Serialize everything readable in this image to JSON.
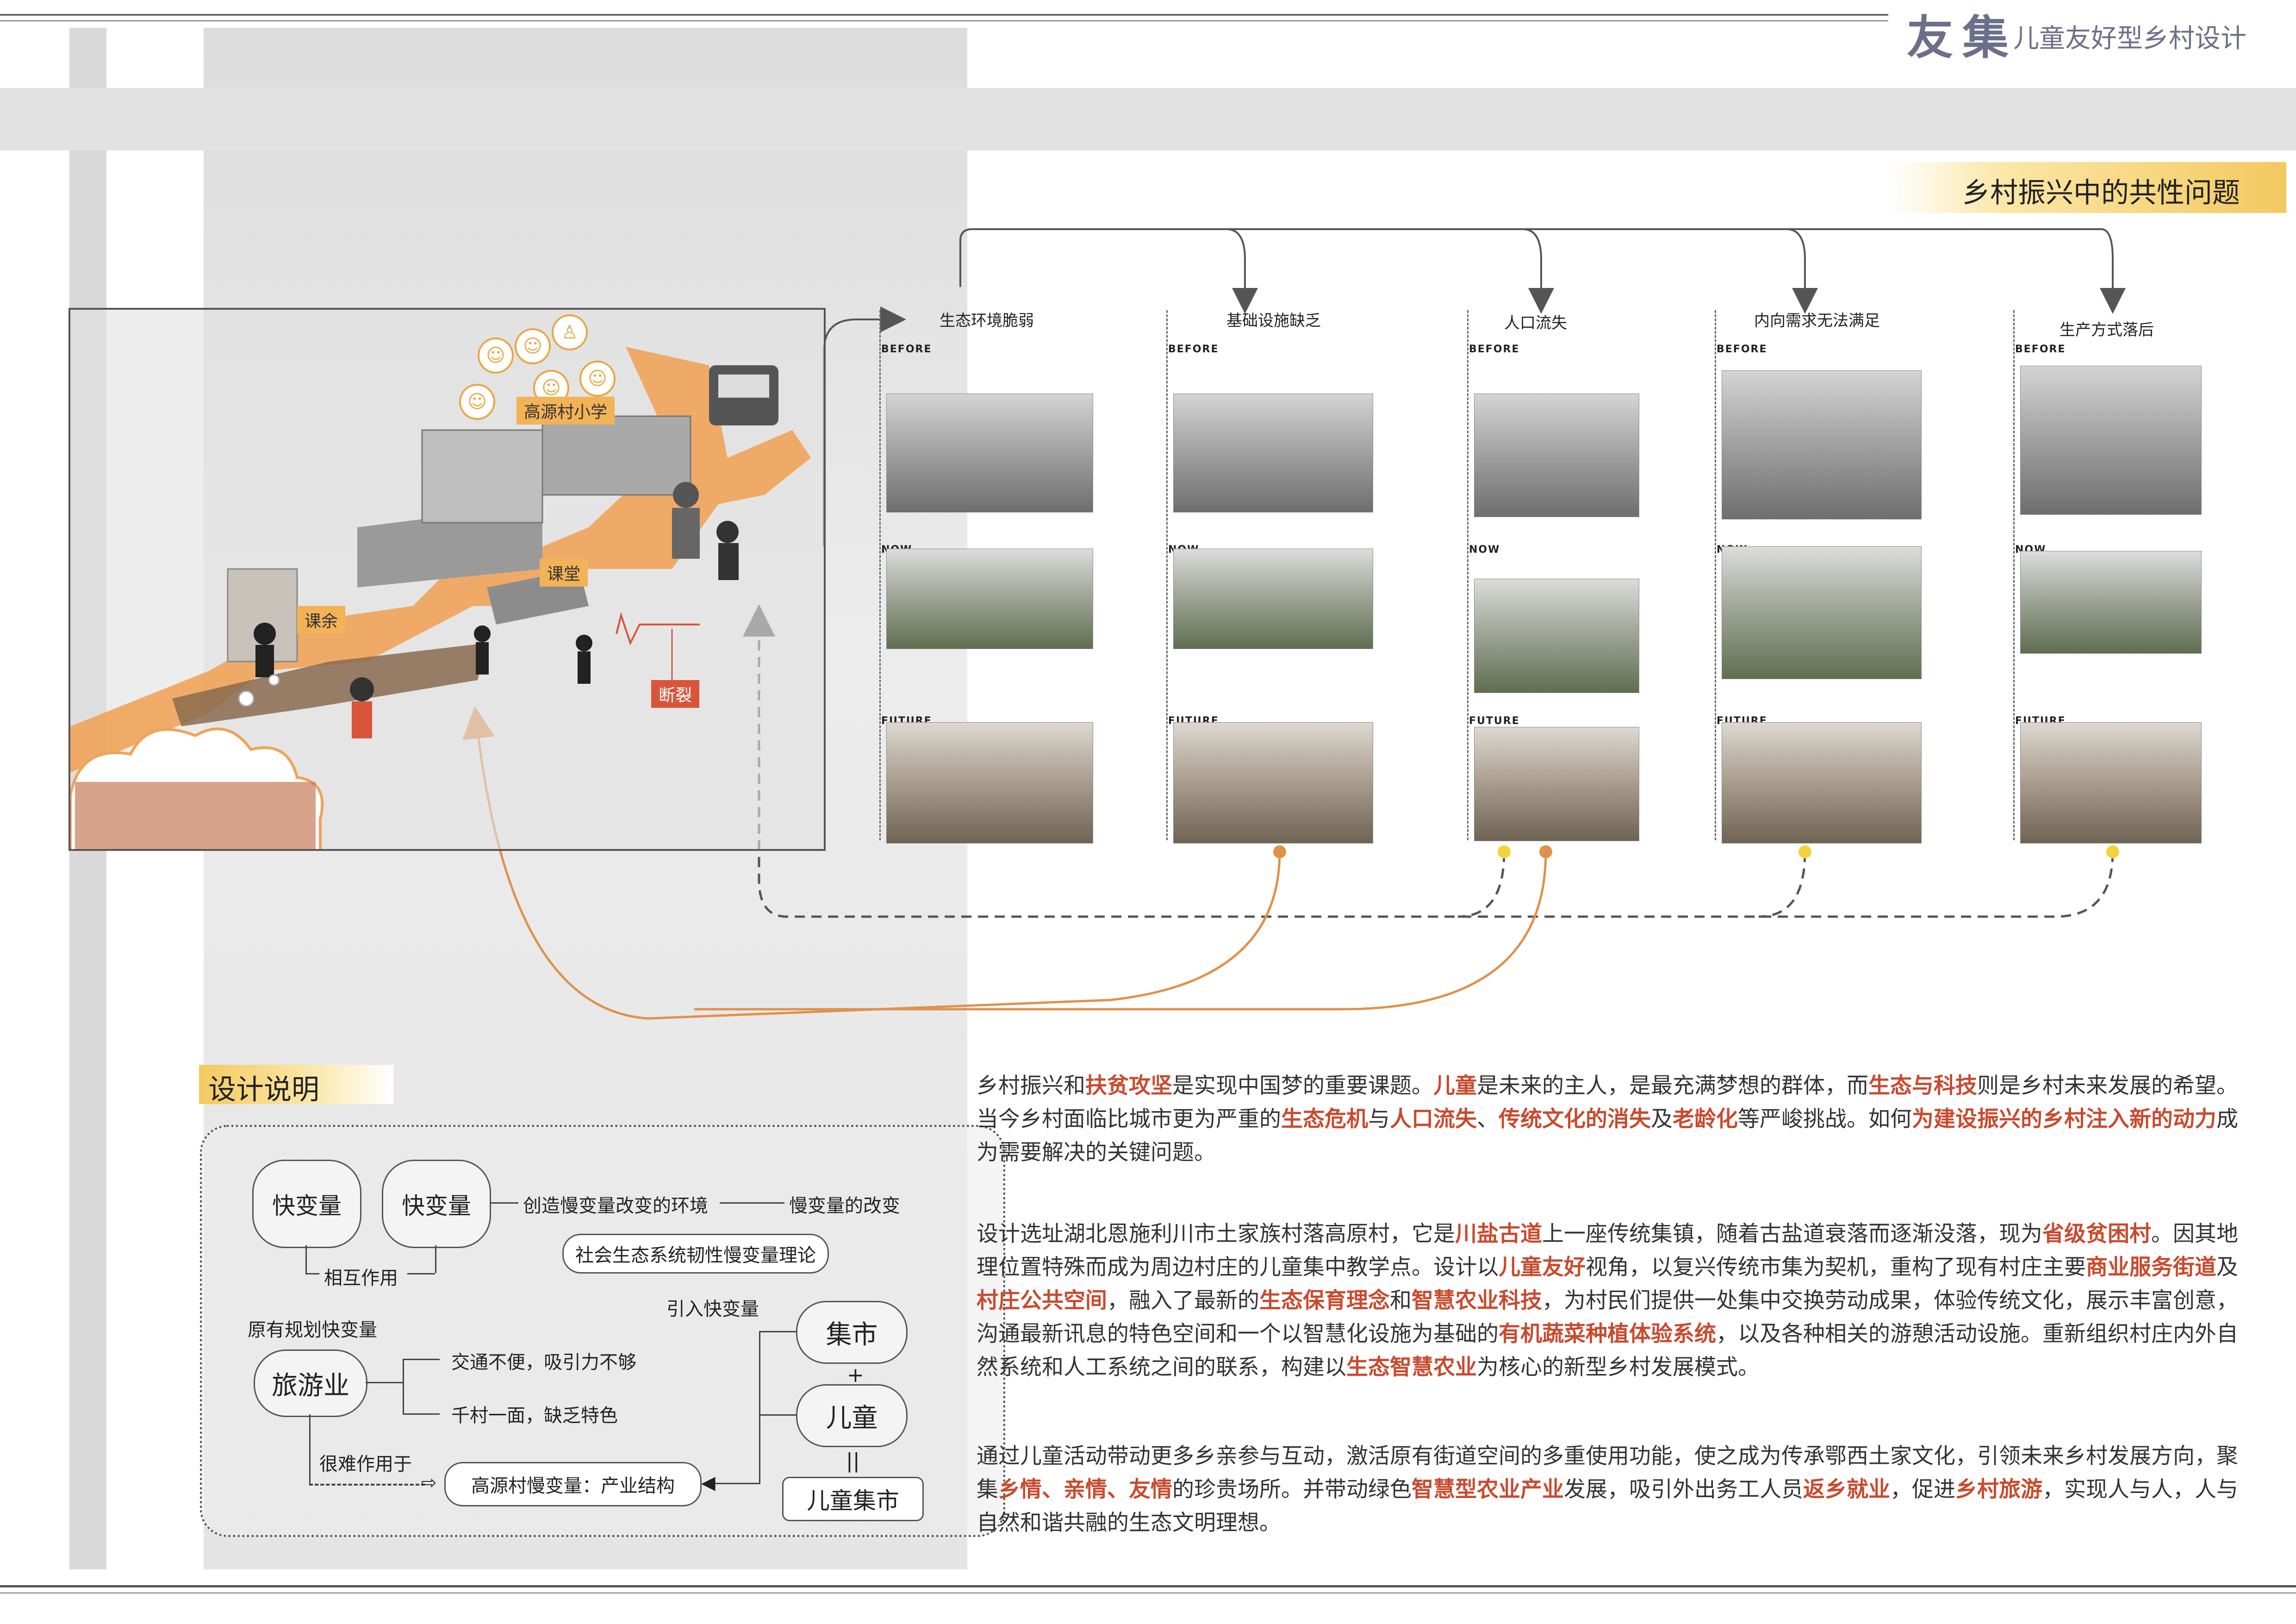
{
  "header": {
    "brand": "友集",
    "subtitle": "儿童友好型乡村设计"
  },
  "problems": {
    "title": "乡村振兴中的共性问题",
    "stages": [
      "BEFORE",
      "NOW",
      "FUTURE"
    ],
    "columns": [
      {
        "title": "生态环境脆弱"
      },
      {
        "title": "基础设施缺乏"
      },
      {
        "title": "人口流失"
      },
      {
        "title": "内向需求无法满足"
      },
      {
        "title": "生产方式落后"
      }
    ]
  },
  "site_map": {
    "labels": {
      "school": "高源村小学",
      "classroom": "课堂",
      "afterclass": "课余",
      "break": "断裂"
    }
  },
  "design": {
    "title": "设计说明",
    "bubble_fast1": "快变量",
    "bubble_fast2": "快变量",
    "create_env": "创造慢变量改变的环境",
    "slow_change": "慢变量的改变",
    "interaction": "相互作用",
    "theory": "社会生态系统韧性慢变量理论",
    "original_fast": "原有规划快变量",
    "introduce_fast": "引入快变量",
    "tourism": "旅游业",
    "traffic": "交通不便，吸引力不够",
    "uniform": "千村一面，缺乏特色",
    "market": "集市",
    "plus": "+",
    "children": "儿童",
    "equals": "||",
    "hard_effect": "很难作用于",
    "slow_var": "高源村慢变量：产业结构",
    "children_market": "儿童集市"
  },
  "paragraphs": {
    "p1": [
      {
        "t": "乡村振兴和"
      },
      {
        "t": "扶贫攻坚",
        "em": true
      },
      {
        "t": "是实现中国梦的重要课题。"
      },
      {
        "t": "儿童",
        "em": true
      },
      {
        "t": "是未来的主人，是最充满梦想的群体，而"
      },
      {
        "t": "生态与科技",
        "em": true
      },
      {
        "t": "则是乡村未来发展的希望。当今乡村面临比城市更为严重的"
      },
      {
        "t": "生态危机",
        "em": true
      },
      {
        "t": "与"
      },
      {
        "t": "人口流失",
        "em": true
      },
      {
        "t": "、"
      },
      {
        "t": "传统文化的消失",
        "em": true
      },
      {
        "t": "及"
      },
      {
        "t": "老龄化",
        "em": true
      },
      {
        "t": "等严峻挑战。如何"
      },
      {
        "t": "为建设振兴的乡村注入新的动力",
        "em": true
      },
      {
        "t": "成为需要解决的关键问题。"
      }
    ],
    "p2": [
      {
        "t": "设计选址湖北恩施利川市土家族村落高原村，它是"
      },
      {
        "t": "川盐古道",
        "em": true
      },
      {
        "t": "上一座传统集镇，随着古盐道衰落而逐渐没落，现为"
      },
      {
        "t": "省级贫困村",
        "em": true
      },
      {
        "t": "。因其地理位置特殊而成为周边村庄的儿童集中教学点。设计以"
      },
      {
        "t": "儿童友好",
        "em": true
      },
      {
        "t": "视角，以复兴传统市集为契机，重构了现有村庄主要"
      },
      {
        "t": "商业服务街道",
        "em": true
      },
      {
        "t": "及"
      },
      {
        "t": "村庄公共空间",
        "em": true
      },
      {
        "t": "，融入了最新的"
      },
      {
        "t": "生态保育理念",
        "em": true
      },
      {
        "t": "和"
      },
      {
        "t": "智慧农业科技",
        "em": true
      },
      {
        "t": "，为村民们提供一处集中交换劳动成果，体验传统文化，展示丰富创意，沟通最新讯息的特色空间和一个以智慧化设施为基础的"
      },
      {
        "t": "有机蔬菜种植体验系统",
        "em": true
      },
      {
        "t": "，以及各种相关的游憩活动设施。重新组织村庄内外自然系统和人工系统之间的联系，构建以"
      },
      {
        "t": "生态智慧农业",
        "em": true
      },
      {
        "t": "为核心的新型乡村发展模式。"
      }
    ],
    "p3": [
      {
        "t": "通过儿童活动带动更多乡亲参与互动，激活原有街道空间的多重使用功能，使之成为传承鄂西土家文化，引领未来乡村发展方向，聚集"
      },
      {
        "t": "乡情、亲情、友情",
        "em": true
      },
      {
        "t": "的珍贵场所。并带动绿色"
      },
      {
        "t": "智慧型农业产业",
        "em": true
      },
      {
        "t": "发展，吸引外出务工人员"
      },
      {
        "t": "返乡就业",
        "em": true
      },
      {
        "t": "，促进"
      },
      {
        "t": "乡村旅游",
        "em": true
      },
      {
        "t": "，实现人与人，人与自然和谐共融的生态文明理想。"
      }
    ]
  },
  "colors": {
    "accent_orange": "#f0a35a",
    "accent_yellow": "#f3c960",
    "emphasis_red": "#c94a2e",
    "brand_slate": "#6d6f8a"
  }
}
